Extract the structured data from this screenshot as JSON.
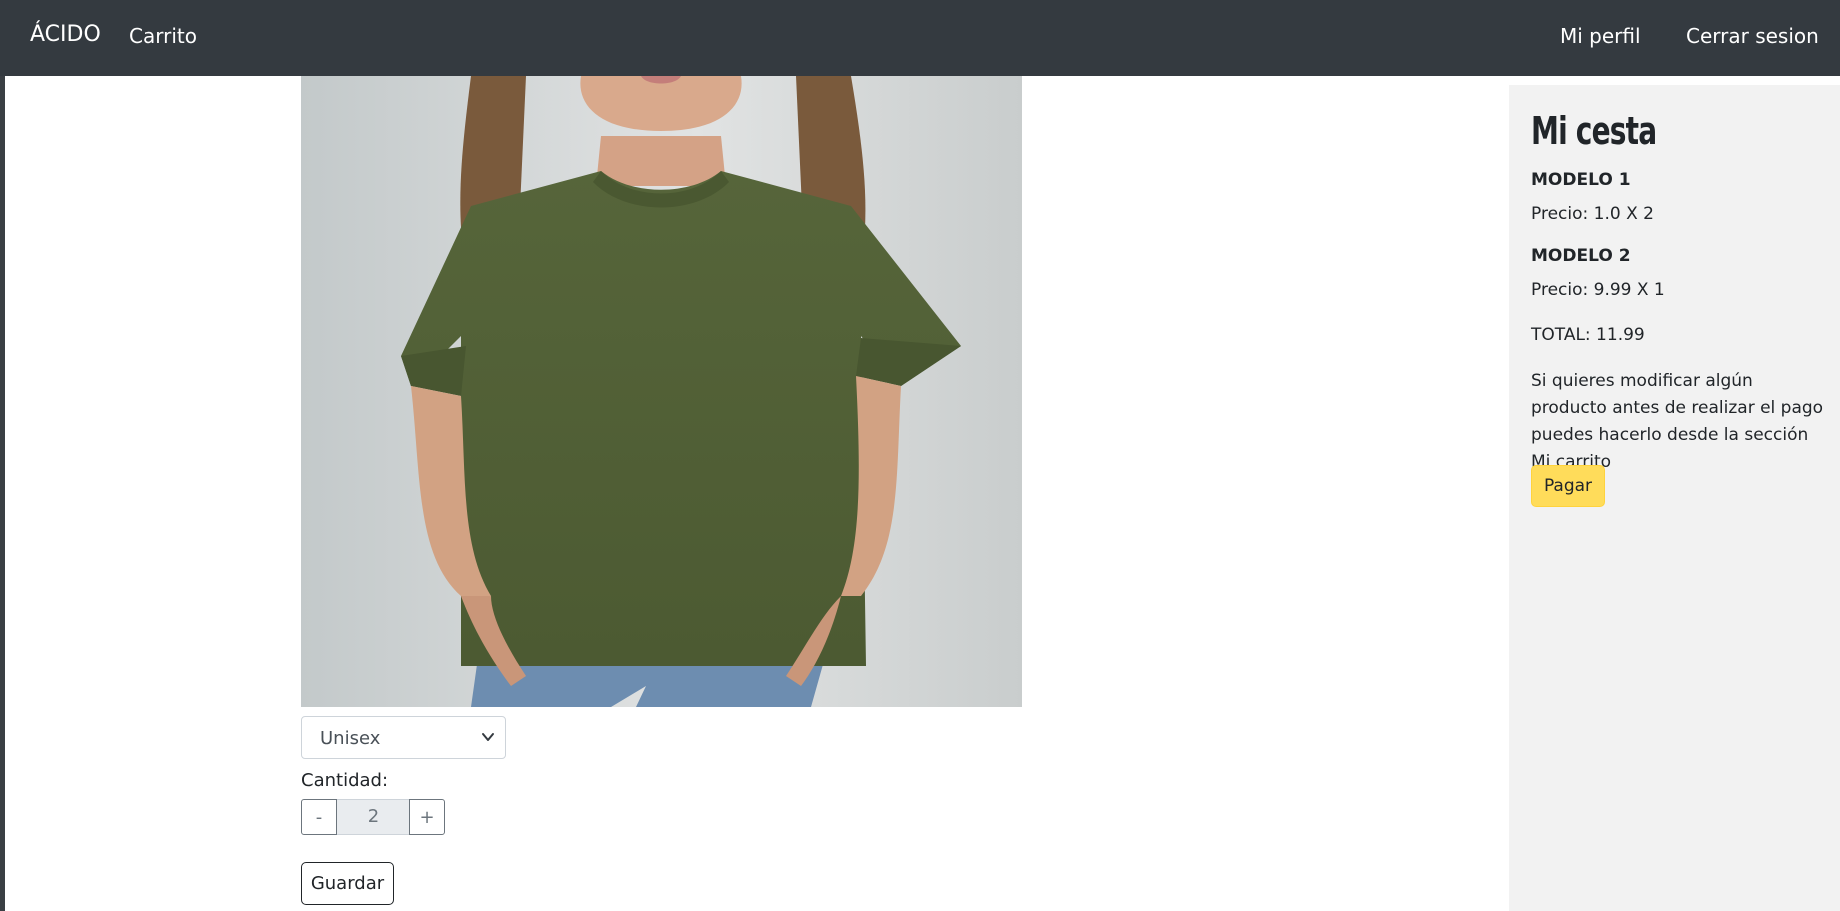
{
  "navbar": {
    "brand": "ÁCIDO",
    "cart_link": "Carrito",
    "profile_link": "Mi perfil",
    "logout_link": "Cerrar sesion"
  },
  "product": {
    "image_description": "model-green-tshirt",
    "gender_select": {
      "selected": "Unisex"
    },
    "quantity_label": "Cantidad:",
    "quantity_minus": "-",
    "quantity_value": "2",
    "quantity_plus": "+",
    "save_label": "Guardar"
  },
  "cart": {
    "title": "Mi cesta",
    "items": [
      {
        "name": "MODELO 1",
        "price": "Precio: 1.0 X 2"
      },
      {
        "name": "MODELO 2",
        "price": "Precio: 9.99 X 1"
      }
    ],
    "total": "TOTAL: 11.99",
    "note": "Si quieres modificar algún producto antes de realizar el pago puedes hacerlo desde la sección Mi carrito",
    "pay_label": "Pagar"
  },
  "colors": {
    "navbar_bg": "#343a40",
    "cart_panel_bg": "#f2f2f2",
    "pay_button_bg": "#ffdc5a",
    "shirt_green": "#5b6a3f"
  }
}
